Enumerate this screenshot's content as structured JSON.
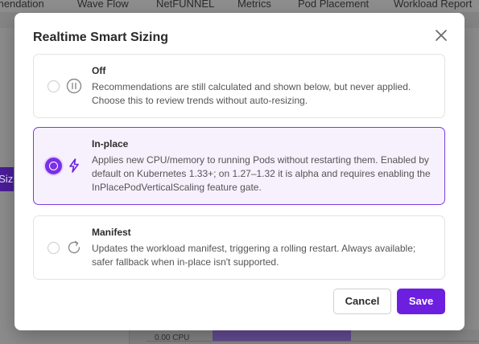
{
  "background": {
    "tabs": [
      "mendation",
      "Wave Flow",
      "NetFUNNEL",
      "Metrics",
      "Pod Placement",
      "Workload Report"
    ],
    "left_button_label": "t Siz",
    "chart_label": "0.00 CPU"
  },
  "modal": {
    "title": "Realtime Smart Sizing",
    "options": [
      {
        "title": "Off",
        "description": "Recommendations are still calculated and shown below, but never applied. Choose this to review trends without auto-resizing.",
        "icon": "pause-icon",
        "selected": false
      },
      {
        "title": "In-place",
        "description": "Applies new CPU/memory to running Pods without restarting them. Enabled by default on Kubernetes 1.33+; on 1.27–1.32 it is alpha and requires enabling the InPlacePodVerticalScaling feature gate.",
        "icon": "lightning-icon",
        "selected": true
      },
      {
        "title": "Manifest",
        "description": "Updates the workload manifest, triggering a rolling restart. Always available; safer fallback when in-place isn't supported.",
        "icon": "refresh-icon",
        "selected": false
      }
    ],
    "cancel_label": "Cancel",
    "save_label": "Save"
  },
  "colors": {
    "accent": "#6d1fe0",
    "selected_bg": "#f6f1fd",
    "selected_border": "#7d3be0"
  }
}
